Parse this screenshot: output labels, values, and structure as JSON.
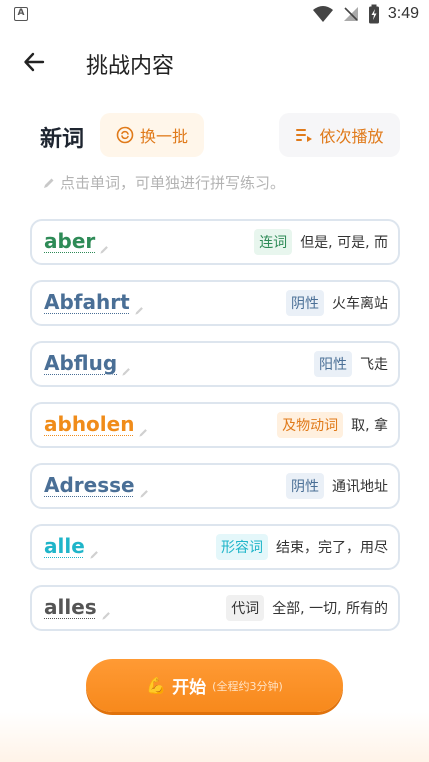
{
  "status": {
    "time": "3:49",
    "app_glyph": "A"
  },
  "header": {
    "title": "挑战内容"
  },
  "section": {
    "title": "新词",
    "swap_label": "换一批",
    "play_label": "依次播放",
    "hint": "点击单词，可单独进行拼写练习。"
  },
  "words": [
    {
      "word": "aber",
      "tag": "连词",
      "meaning": "但是, 可是, 而",
      "color": "#2e8b57",
      "tag_bg": "#e8f6ee",
      "tag_color": "#2e8b57"
    },
    {
      "word": "Abfahrt",
      "tag": "阴性",
      "meaning": "火车离站",
      "color": "#4a6f96",
      "tag_bg": "#eaf0f7",
      "tag_color": "#4a6f96"
    },
    {
      "word": "Abflug",
      "tag": "阳性",
      "meaning": "飞走",
      "color": "#4a6f96",
      "tag_bg": "#eaf0f7",
      "tag_color": "#4a6f96"
    },
    {
      "word": "abholen",
      "tag": "及物动词",
      "meaning": "取, 拿",
      "color": "#f08c1a",
      "tag_bg": "#fff0df",
      "tag_color": "#e07a1a"
    },
    {
      "word": "Adresse",
      "tag": "阴性",
      "meaning": "通讯地址",
      "color": "#4a6f96",
      "tag_bg": "#eaf0f7",
      "tag_color": "#4a6f96"
    },
    {
      "word": "alle",
      "tag": "形容词",
      "meaning": "结束，完了，用尽",
      "color": "#1fb5c9",
      "tag_bg": "#e4f7fa",
      "tag_color": "#1fb5c9"
    },
    {
      "word": "alles",
      "tag": "代词",
      "meaning": "全部, 一切, 所有的",
      "color": "#555555",
      "tag_bg": "#f0f0f0",
      "tag_color": "#333333"
    }
  ],
  "start": {
    "label": "开始",
    "sub": "(全程约3分钟)"
  }
}
